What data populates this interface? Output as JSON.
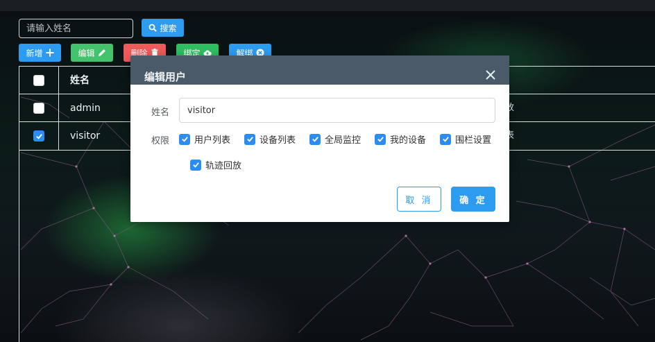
{
  "toolbar": {
    "search_placeholder": "请输入姓名",
    "search_label": "搜索",
    "add_label": "新增",
    "edit_label": "编辑",
    "delete_label": "删除",
    "bind_label": "绑定",
    "unbind_label": "解绑"
  },
  "table": {
    "header_name": "姓名",
    "rows": [
      {
        "name": "admin",
        "checked": false,
        "trailing": "放"
      },
      {
        "name": "visitor",
        "checked": true,
        "trailing": "表"
      }
    ]
  },
  "modal": {
    "title": "编辑用户",
    "name_label": "姓名",
    "name_value": "visitor",
    "perm_label": "权限",
    "permissions": [
      {
        "label": "用户列表",
        "checked": true
      },
      {
        "label": "设备列表",
        "checked": true
      },
      {
        "label": "全局监控",
        "checked": true
      },
      {
        "label": "我的设备",
        "checked": true
      },
      {
        "label": "围栏设置",
        "checked": true
      },
      {
        "label": "轨迹回放",
        "checked": true
      }
    ],
    "cancel_label": "取 消",
    "ok_label": "确 定"
  },
  "colors": {
    "primary": "#2d9cf0",
    "success": "#43c36b",
    "danger": "#ef5a5a",
    "modal_header": "#4b5a69"
  }
}
